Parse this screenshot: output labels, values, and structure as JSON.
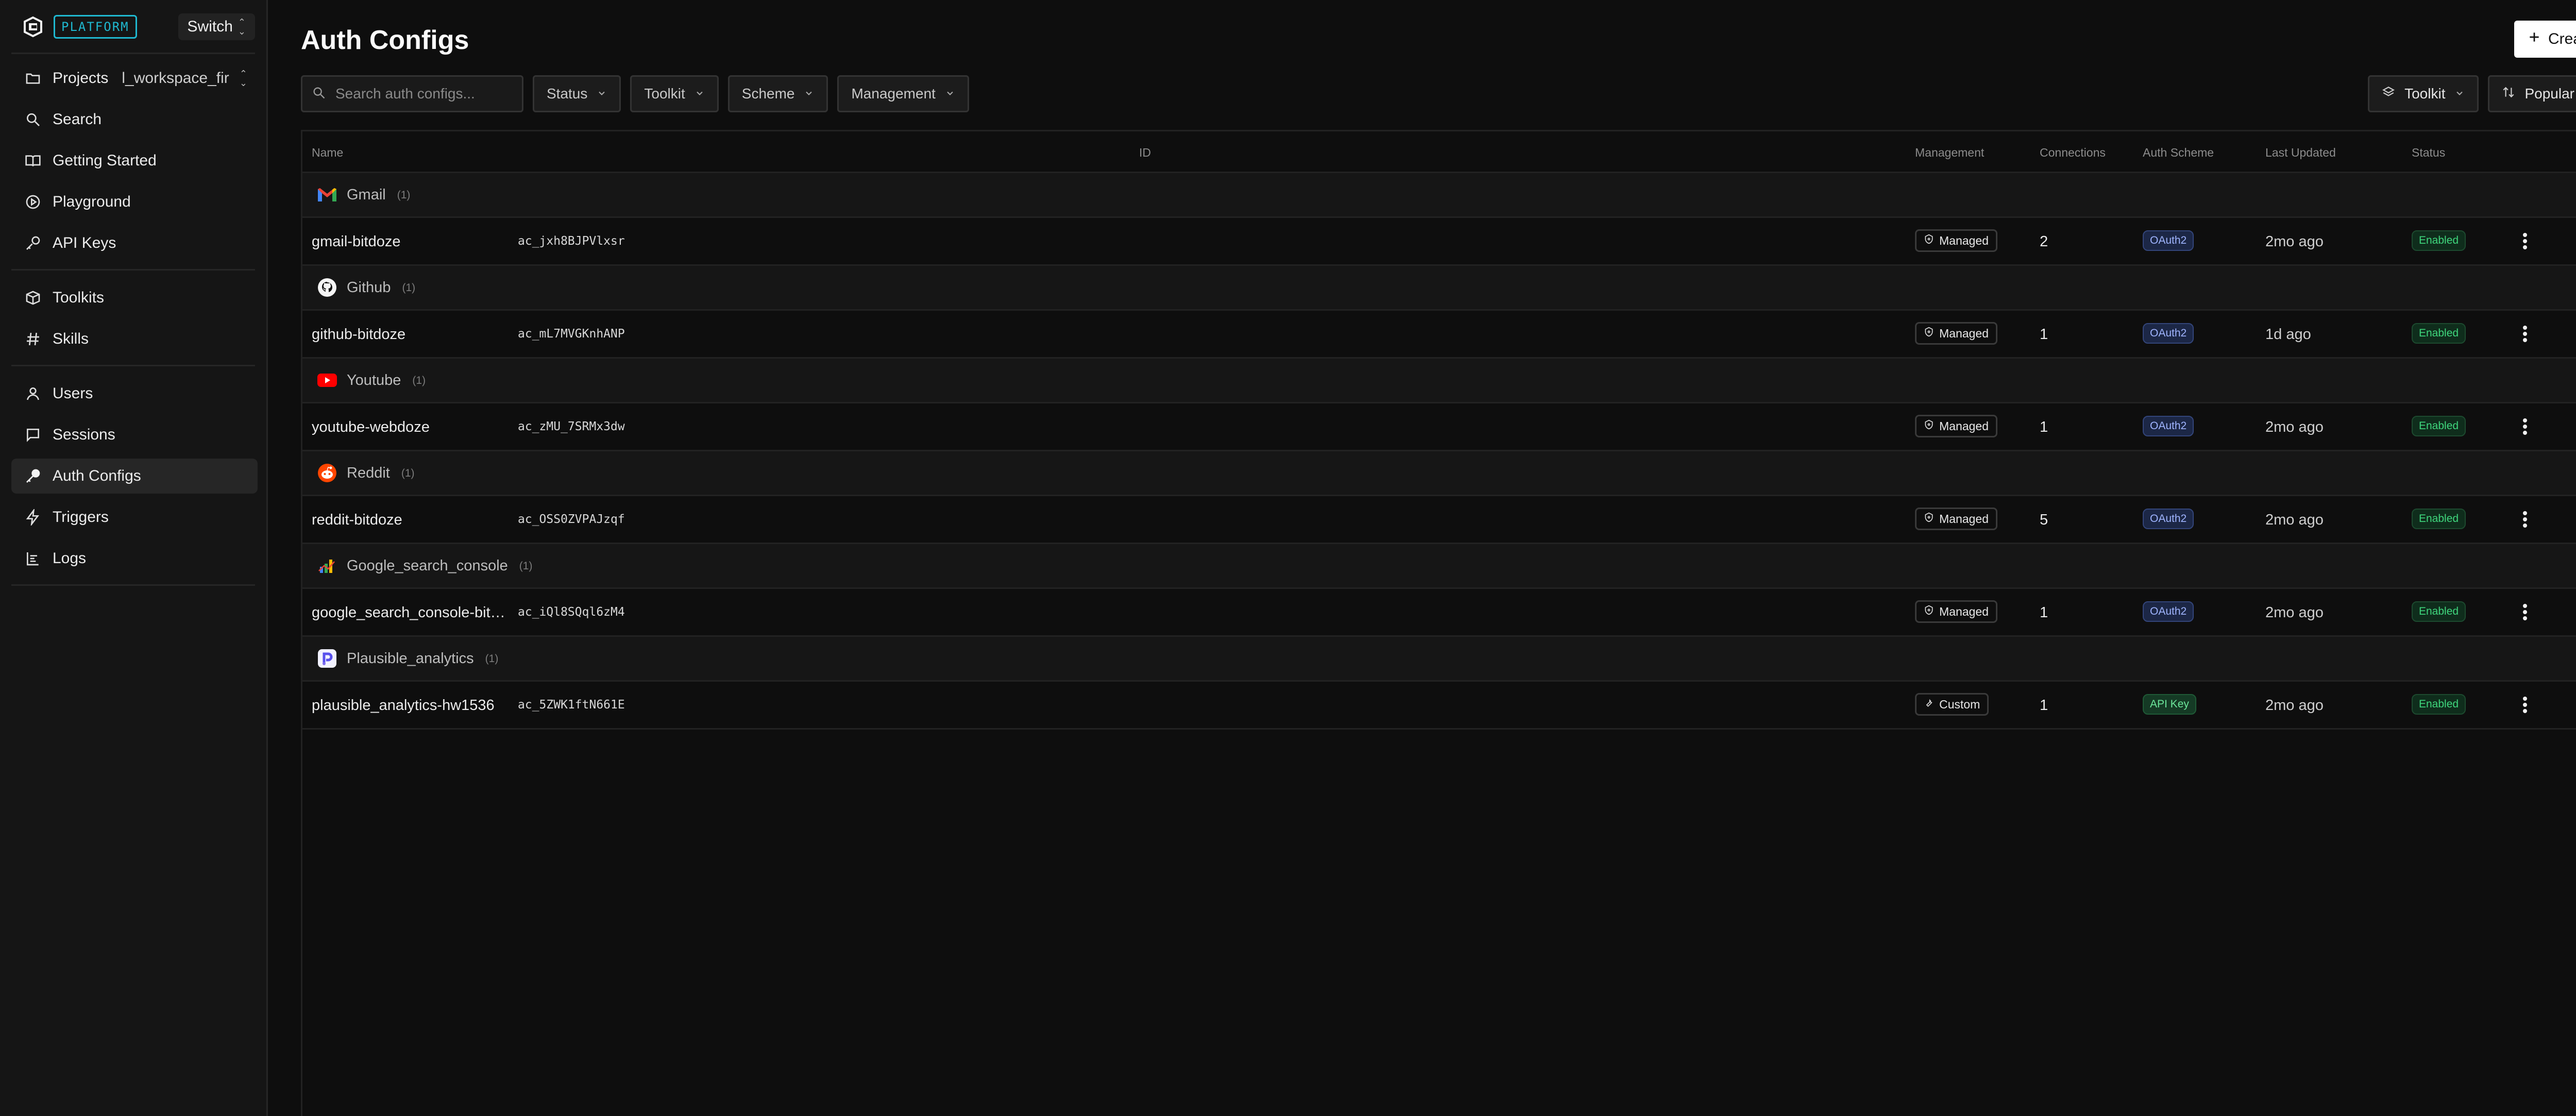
{
  "sidebar": {
    "brand_badge": "PLATFORM",
    "switch_label": "Switch",
    "projects": {
      "label": "Projects",
      "value": "l_workspace_fir"
    },
    "items": [
      {
        "label": "Search",
        "icon": "search-icon"
      },
      {
        "label": "Getting Started",
        "icon": "book-icon"
      },
      {
        "label": "Playground",
        "icon": "play-circle-icon"
      },
      {
        "label": "API Keys",
        "icon": "key-icon"
      },
      {
        "label": "Toolkits",
        "icon": "box-icon"
      },
      {
        "label": "Skills",
        "icon": "hash-icon"
      },
      {
        "label": "Users",
        "icon": "user-icon"
      },
      {
        "label": "Sessions",
        "icon": "message-icon"
      },
      {
        "label": "Auth Configs",
        "icon": "key-fill-icon",
        "active": true
      },
      {
        "label": "Triggers",
        "icon": "zap-icon"
      },
      {
        "label": "Logs",
        "icon": "logs-icon"
      }
    ]
  },
  "header": {
    "title": "Auth Configs",
    "create_label": "Create"
  },
  "toolbar": {
    "search_placeholder": "Search auth configs...",
    "filters": [
      "Status",
      "Toolkit",
      "Scheme",
      "Management"
    ],
    "group_by": "Toolkit",
    "sort": "Popular"
  },
  "table": {
    "columns": [
      "Name",
      "ID",
      "Management",
      "Connections",
      "Auth Scheme",
      "Last Updated",
      "Status"
    ],
    "groups": [
      {
        "name": "Gmail",
        "count": "(1)",
        "icon": "gmail-icon",
        "row": {
          "name": "gmail-bitdoze",
          "id": "ac_jxh8BJPVlxsr",
          "management": "Managed",
          "connections": "2",
          "scheme": "OAuth2",
          "updated": "2mo ago",
          "status": "Enabled"
        }
      },
      {
        "name": "Github",
        "count": "(1)",
        "icon": "github-icon",
        "row": {
          "name": "github-bitdoze",
          "id": "ac_mL7MVGKnhANP",
          "management": "Managed",
          "connections": "1",
          "scheme": "OAuth2",
          "updated": "1d ago",
          "status": "Enabled"
        }
      },
      {
        "name": "Youtube",
        "count": "(1)",
        "icon": "youtube-icon",
        "row": {
          "name": "youtube-webdoze",
          "id": "ac_zMU_7SRMx3dw",
          "management": "Managed",
          "connections": "1",
          "scheme": "OAuth2",
          "updated": "2mo ago",
          "status": "Enabled"
        }
      },
      {
        "name": "Reddit",
        "count": "(1)",
        "icon": "reddit-icon",
        "row": {
          "name": "reddit-bitdoze",
          "id": "ac_OSS0ZVPAJzqf",
          "management": "Managed",
          "connections": "5",
          "scheme": "OAuth2",
          "updated": "2mo ago",
          "status": "Enabled"
        }
      },
      {
        "name": "Google_search_console",
        "count": "(1)",
        "icon": "google-search-console-icon",
        "row": {
          "name": "google_search_console-bit…",
          "id": "ac_iQl8SQql6zM4",
          "management": "Managed",
          "connections": "1",
          "scheme": "OAuth2",
          "updated": "2mo ago",
          "status": "Enabled"
        }
      },
      {
        "name": "Plausible_analytics",
        "count": "(1)",
        "icon": "plausible-icon",
        "row": {
          "name": "plausible_analytics-hw1536",
          "id": "ac_5ZWK1ftN661E",
          "management": "Custom",
          "connections": "1",
          "scheme": "API Key",
          "updated": "2mo ago",
          "status": "Enabled"
        }
      }
    ]
  }
}
